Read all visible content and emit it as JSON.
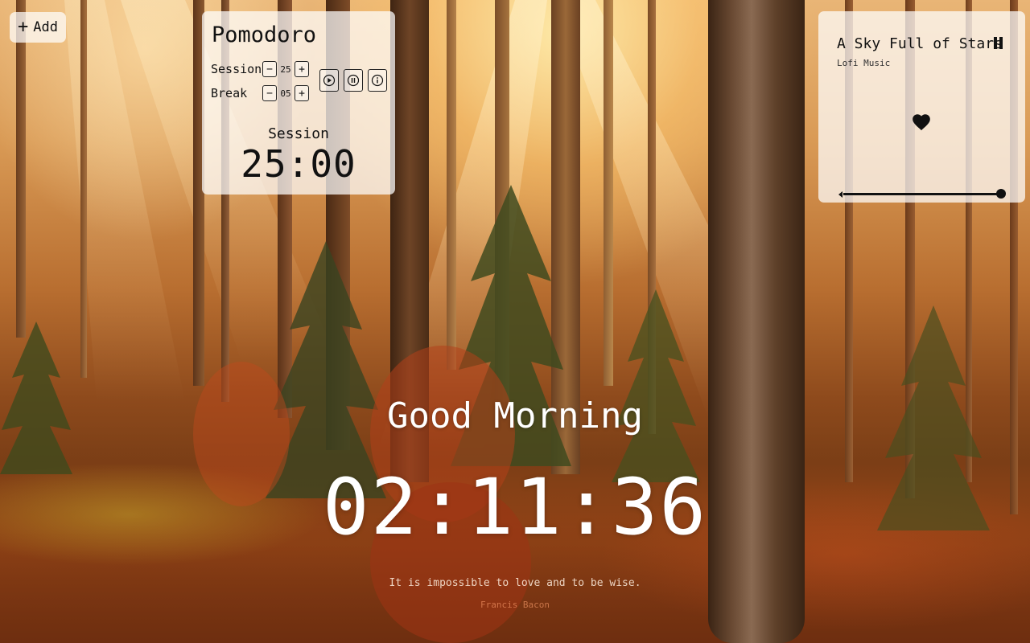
{
  "add_button": {
    "icon": "plus-icon",
    "label": "Add"
  },
  "pomodoro": {
    "title": "Pomodoro",
    "session_label": "Session",
    "session_value": "25",
    "break_label": "Break",
    "break_value": "05",
    "decrement_symbol": "−",
    "increment_symbol": "+",
    "controls": [
      "play-icon",
      "pause-icon",
      "info-icon"
    ],
    "mode": "Session",
    "time": "25:00"
  },
  "music": {
    "title": "A Sky Full of Stars",
    "artist": "Lofi Music",
    "playing": true,
    "liked": true,
    "volume": 1.0
  },
  "greeting": "Good Morning",
  "clock": "02:11:36",
  "quote": {
    "text": "It is impossible to love and to be wise.",
    "author": "Francis Bacon"
  },
  "colors": {
    "panel_bg": "rgba(255,255,255,0.72)",
    "text_dark": "#111111",
    "text_light": "#ffffff"
  }
}
